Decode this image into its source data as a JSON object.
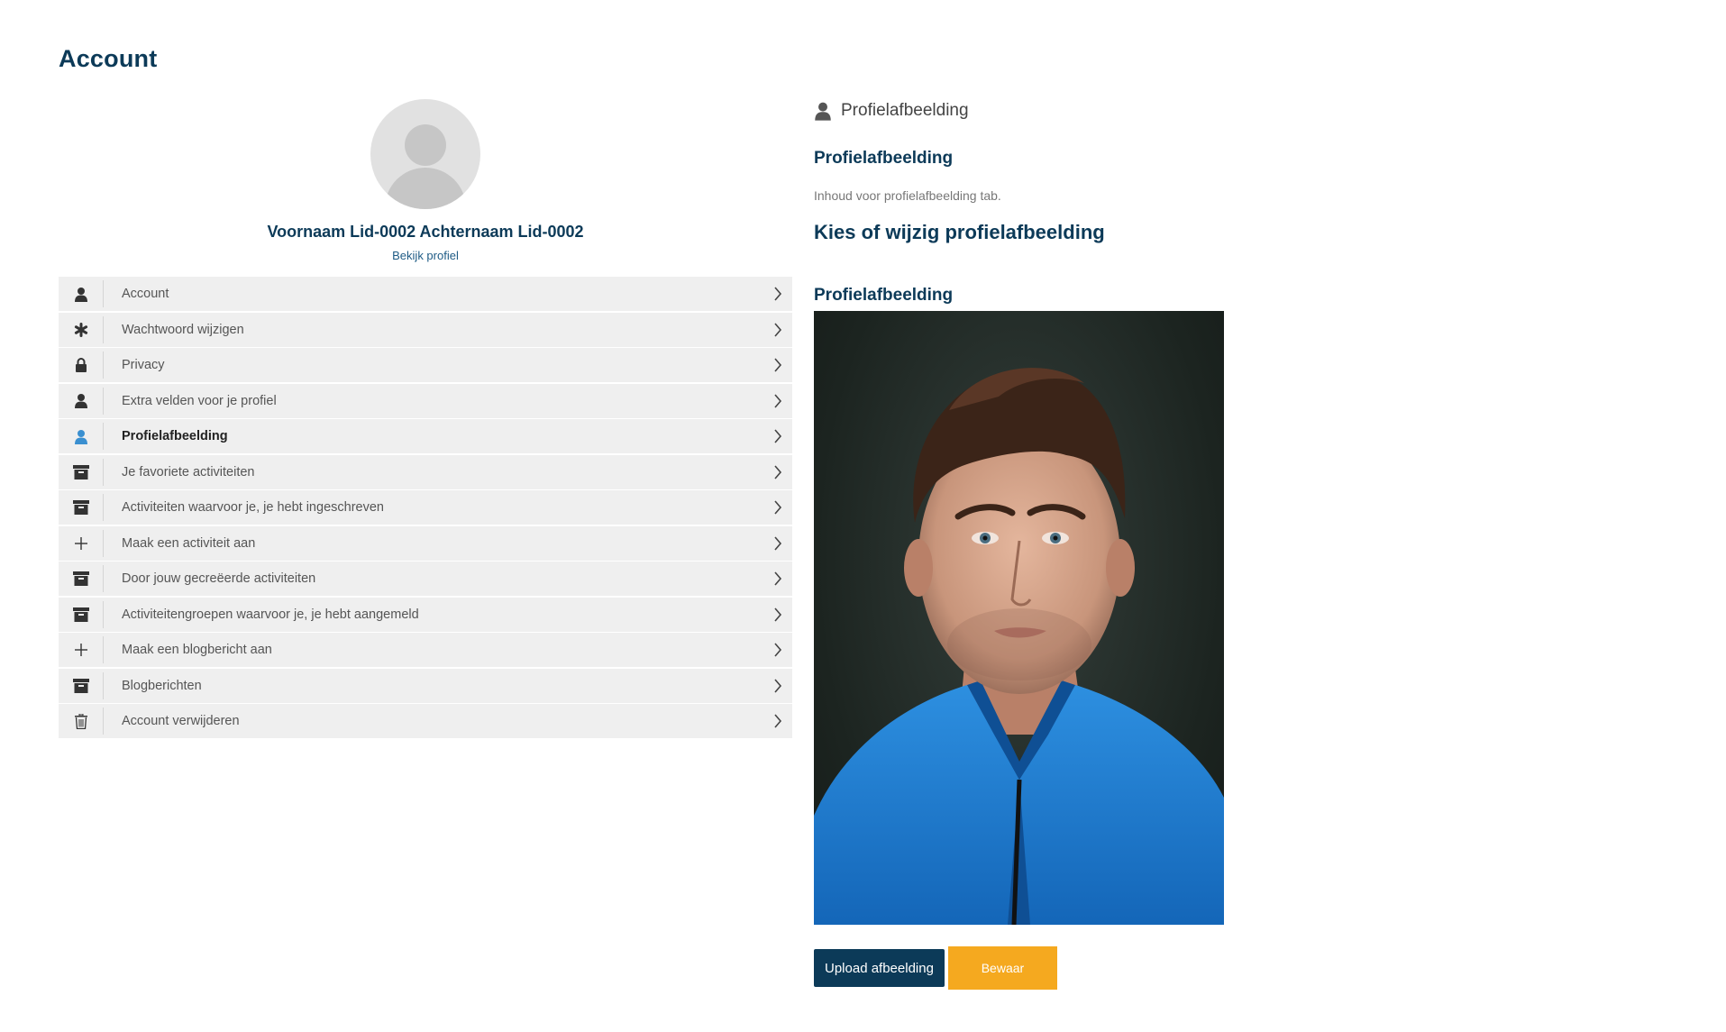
{
  "page": {
    "title": "Account"
  },
  "profile": {
    "name": "Voornaam Lid-0002 Achternaam Lid-0002",
    "view_profile": "Bekijk profiel"
  },
  "menu": {
    "items": [
      {
        "label": "Account",
        "icon": "user-icon"
      },
      {
        "label": "Wachtwoord wijzigen",
        "icon": "asterisk-icon"
      },
      {
        "label": "Privacy",
        "icon": "lock-icon"
      },
      {
        "label": "Extra velden voor je profiel",
        "icon": "user-icon"
      },
      {
        "label": "Profielafbeelding",
        "icon": "user-icon",
        "active": true
      },
      {
        "label": "Je favoriete activiteiten",
        "icon": "archive-icon"
      },
      {
        "label": "Activiteiten waarvoor je, je hebt ingeschreven",
        "icon": "archive-icon"
      },
      {
        "label": "Maak een activiteit aan",
        "icon": "plus-icon"
      },
      {
        "label": "Door jouw gecreëerde activiteiten",
        "icon": "archive-icon"
      },
      {
        "label": "Activiteitengroepen waarvoor je, je hebt aangemeld",
        "icon": "archive-icon"
      },
      {
        "label": "Maak een blogbericht aan",
        "icon": "plus-icon"
      },
      {
        "label": "Blogberichten",
        "icon": "archive-icon"
      },
      {
        "label": "Account verwijderen",
        "icon": "trash-icon"
      }
    ]
  },
  "content": {
    "section_title": "Profielafbeelding",
    "sub_title": "Profielafbeelding",
    "sub_text": "Inhoud voor profielafbeelding tab.",
    "choose_title": "Kies of wijzig profielafbeelding",
    "picture_label": "Profielafbeelding",
    "upload_button": "Upload afbeelding",
    "save_button": "Bewaar"
  },
  "colors": {
    "brand": "#0c3a58",
    "accent": "#f5a91f",
    "active_icon": "#3a8fd0",
    "menu_bg": "#efefef"
  }
}
